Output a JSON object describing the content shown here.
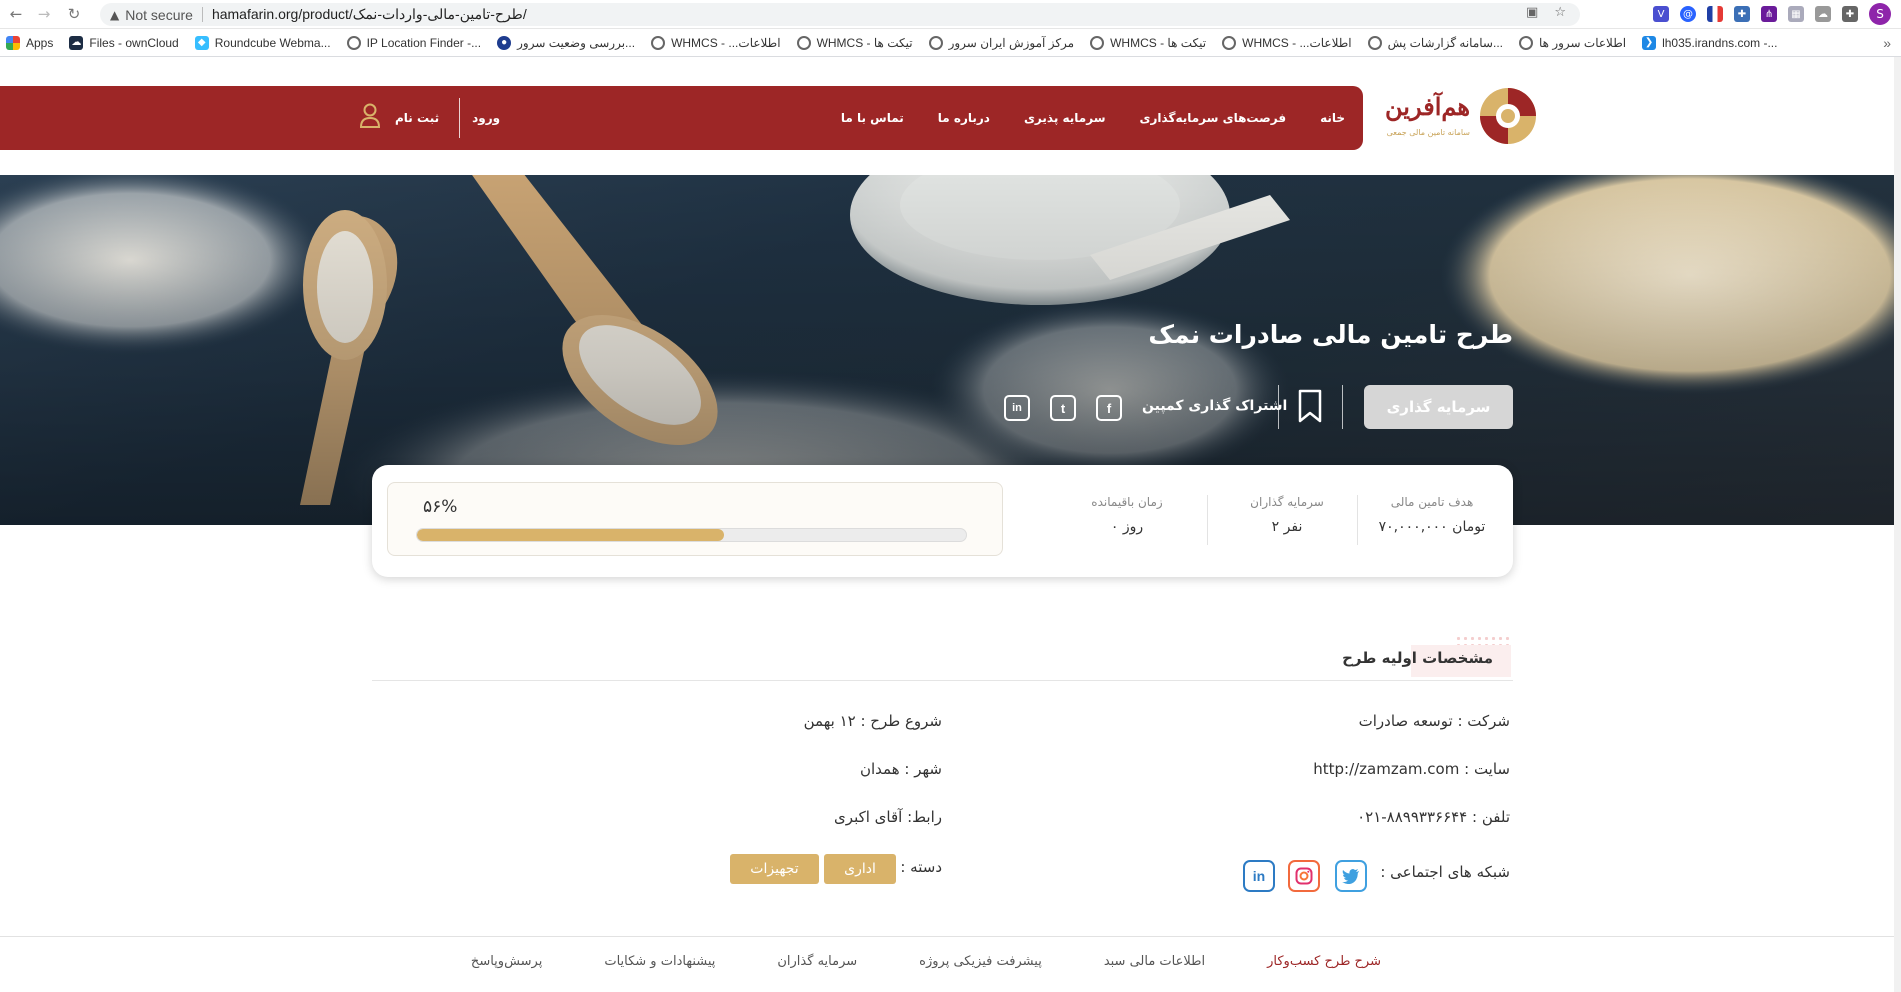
{
  "browser": {
    "security_label": "Not secure",
    "url": "hamafarin.org/product/طرح-تامین-مالی-واردات-نمک/",
    "profile_initial": "S"
  },
  "bookmarks": [
    "Apps",
    "Files - ownCloud",
    "Roundcube Webma...",
    "IP Location Finder -...",
    "بررسی وضعیت سرور...",
    "WHMCS - ...اطلاعات",
    "WHMCS - تیکت ها",
    "مرکز آموزش ایران سرور",
    "WHMCS - تیکت ها",
    "WHMCS - ...اطلاعات",
    "سامانه گزارشات پش...",
    "اطلاعات سرور ها",
    "lh035.irandns.com -..."
  ],
  "header": {
    "brand_name": "هم‌آفرین",
    "brand_sub": "سامانه تامین مالی جمعی",
    "nav": [
      "خانه",
      "فرصت‌های سرمایه‌گذاری",
      "سرمایه پذیری",
      "درباره ما",
      "تماس با ما"
    ],
    "login": "ورود",
    "register": "ثبت نام"
  },
  "hero": {
    "title": "طرح تامین مالی صادرات نمک",
    "invest_button": "سرمایه گذاری",
    "share_label": "اشتراک گذاری کمپین",
    "social": [
      "f",
      "t",
      "in"
    ]
  },
  "stats": {
    "goal_label": "هدف تامین مالی",
    "goal_value": "۷۰,۰۰۰,۰۰۰ تومان",
    "investors_label": "سرمایه گذاران",
    "investors_value": "۲ نفر",
    "remaining_label": "زمان باقیمانده",
    "remaining_value": "۰ روز",
    "progress_text": "۵۶%",
    "progress_fraction": 0.56
  },
  "specs": {
    "section_title": "مشخصات اولیه طرح",
    "company_key": "شرکت :",
    "company_val": "توسعه صادرات",
    "site_key": "سایت :",
    "site_val": "http://zamzam.com",
    "phone_key": "تلفن :",
    "phone_val": "۰۲۱-۸۸۹۹۳۳۶۶۴۴",
    "social_key": "شبکه های اجتماعی :",
    "start_key": "شروع طرح :",
    "start_val": "۱۲ بهمن",
    "city_key": "شهر :",
    "city_val": "همدان",
    "contact_key": "رابط:",
    "contact_val": "آقای اکبری",
    "category_key": "دسته :",
    "categories": [
      "اداری",
      "تجهیزات"
    ]
  },
  "bottom_tabs": [
    "شرح طرح کسب‌وکار",
    "اطلاعات مالی سبد",
    "پیشرفت فیزیکی پروژه",
    "سرمایه گذاران",
    "پیشنهادات و شکایات",
    "پرسش‌وپاسخ"
  ],
  "colors": {
    "brand_red": "#9d2626",
    "accent_gold": "#d9b36a"
  }
}
